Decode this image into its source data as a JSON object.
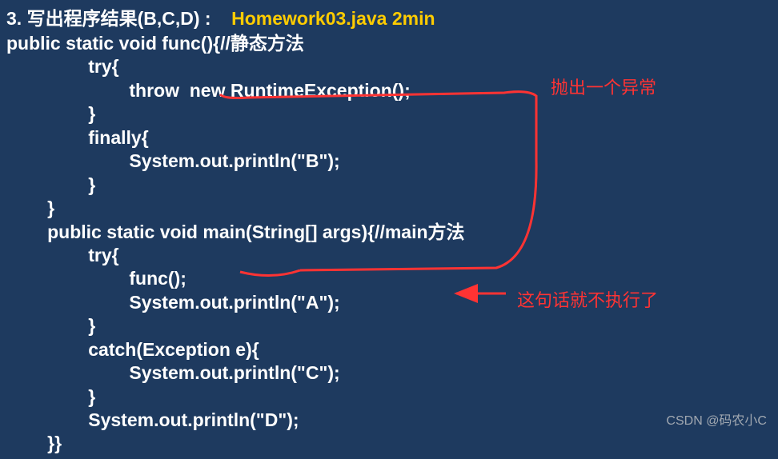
{
  "header": {
    "number": "3.",
    "title_cn": "写出程序结果(B,C,D) :",
    "filename": "Homework03.java 2min"
  },
  "code": {
    "l01": "public static void func(){//静态方法",
    "l02": "                try{",
    "l03": "                        throw  new RuntimeException();",
    "l04": "                }",
    "l05": "                finally{",
    "l06": "                        System.out.println(\"B\");",
    "l07": "                }",
    "l08": "        }",
    "l09": "        public static void main(String[] args){//main方法",
    "l10": "                try{",
    "l11": "                        func();",
    "l12": "                        System.out.println(\"A\");",
    "l13": "                }",
    "l14": "                catch(Exception e){",
    "l15": "                        System.out.println(\"C\");",
    "l16": "                }",
    "l17": "                System.out.println(\"D\");",
    "l18": "        }}"
  },
  "annotations": {
    "a1": "抛出一个异常",
    "a2": "这句话就不执行了"
  },
  "watermark": "CSDN @码农小C"
}
